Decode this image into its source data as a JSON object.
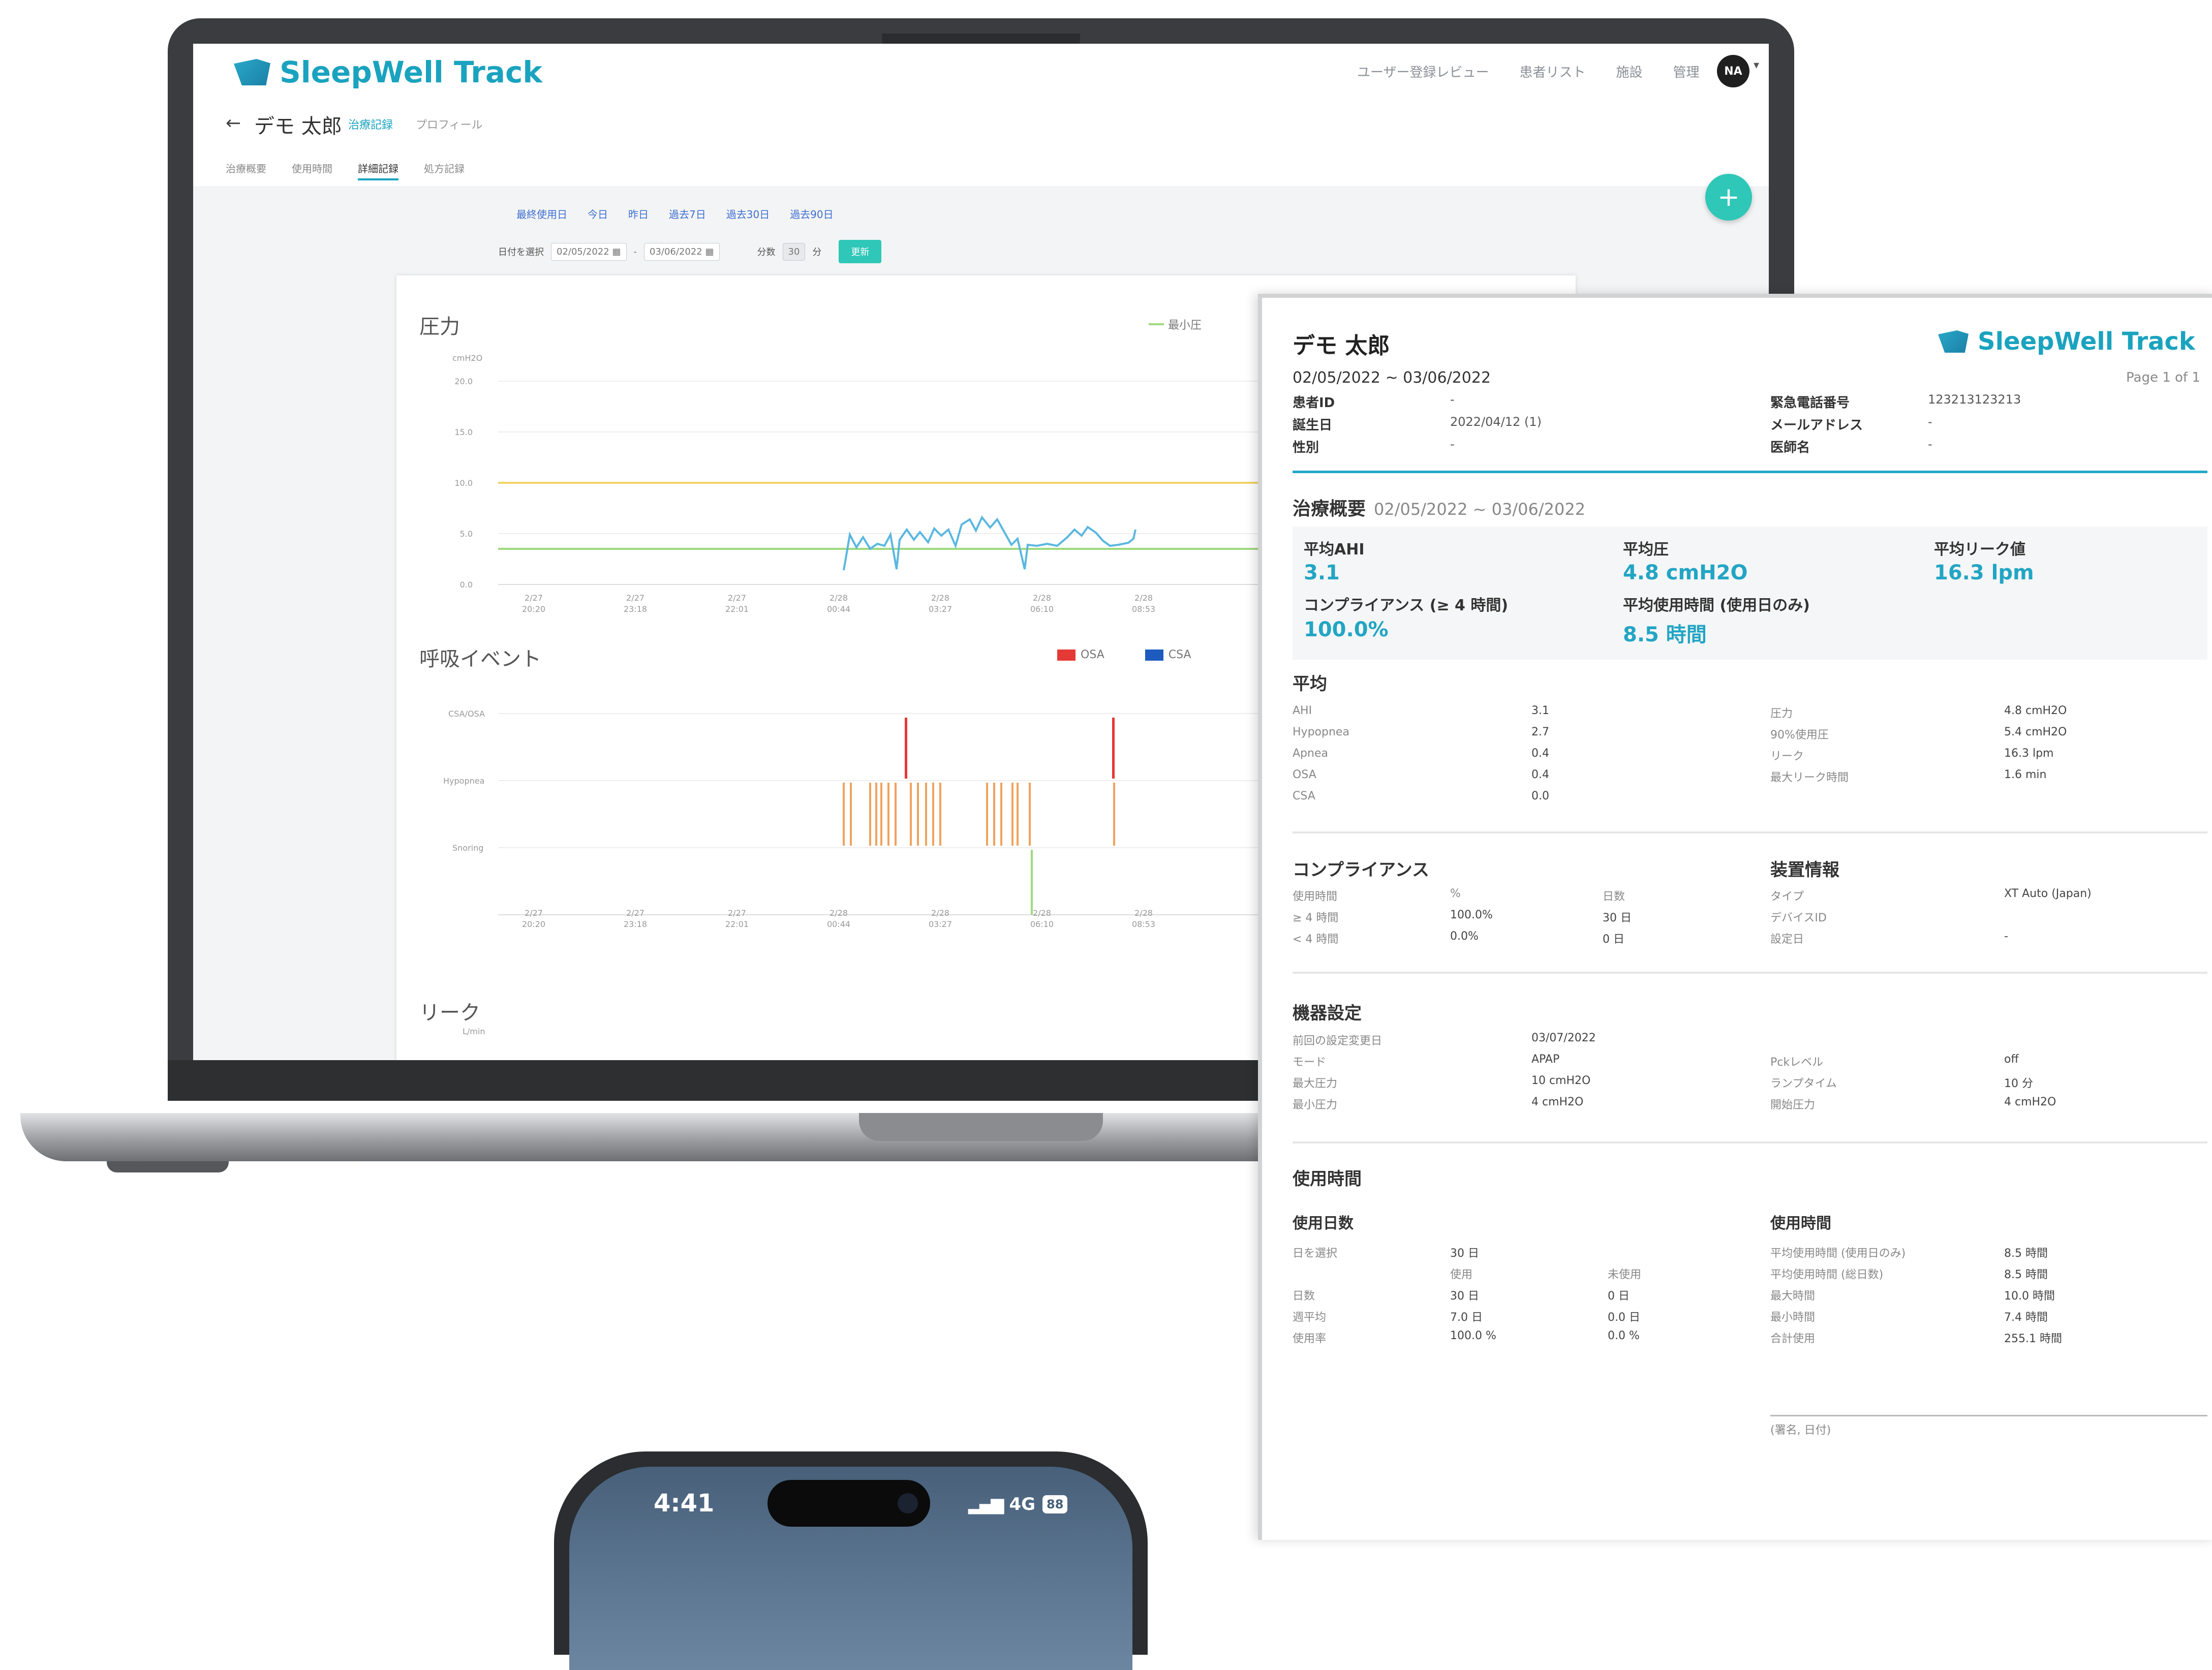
{
  "app": {
    "name": "SleepWell Track",
    "nav": [
      "ユーザー登録レビュー",
      "患者リスト",
      "施設",
      "管理"
    ],
    "avatar_initials": "NA",
    "add_button": "+",
    "patient_name": "デモ 太郎",
    "patient_tabs": [
      "治療記録",
      "プロフィール"
    ],
    "sub_tabs": [
      "治療概要",
      "使用時間",
      "詳細記録",
      "処方記録"
    ],
    "presets": [
      "最終使用日",
      "今日",
      "昨日",
      "過去7日",
      "過去30日",
      "過去90日"
    ],
    "date_label": "日付を選択",
    "date_from": "02/05/2022",
    "date_to": "03/06/2022",
    "interval_label": "分数",
    "interval_value": "30",
    "interval_unit": "分",
    "update_button": "更新",
    "colors": {
      "brand": "#1aa3bf",
      "fab": "#2ec7b8",
      "pressure_line": "#5bb7e0",
      "max_line": "#f3d26a",
      "min_line": "#9fd97f",
      "osa": "#e53935",
      "csa": "#1e5bbf",
      "hypopnea": "#f0a25e",
      "snoring": "#9fd97f"
    }
  },
  "pressure_chart": {
    "title": "圧力",
    "ylabel": "cmH2O",
    "legend": "最小圧",
    "yticks": [
      "20.0",
      "15.0",
      "10.0",
      "5.0",
      "0.0"
    ],
    "xticks": [
      [
        "2/27",
        "20:20"
      ],
      [
        "2/27",
        "23:18"
      ],
      [
        "2/27",
        "22:01"
      ],
      [
        "2/28",
        "00:44"
      ],
      [
        "2/28",
        "03:27"
      ],
      [
        "2/28",
        "06:10"
      ],
      [
        "2/28",
        "08:53"
      ]
    ]
  },
  "events_chart": {
    "title": "呼吸イベント",
    "legend": [
      "OSA",
      "CSA"
    ],
    "rows": [
      "CSA/OSA",
      "Hypopnea",
      "Snoring"
    ],
    "xticks": [
      [
        "2/27",
        "20:20"
      ],
      [
        "2/27",
        "23:18"
      ],
      [
        "2/27",
        "22:01"
      ],
      [
        "2/28",
        "00:44"
      ],
      [
        "2/28",
        "03:27"
      ],
      [
        "2/28",
        "06:10"
      ],
      [
        "2/28",
        "08:53"
      ]
    ]
  },
  "leak_chart": {
    "title": "リーク",
    "ylabel": "L/min"
  },
  "report": {
    "name": "デモ 太郎",
    "range": "02/05/2022 ~ 03/06/2022",
    "page": "Page 1 of 1",
    "info_left": [
      [
        "患者ID",
        "-"
      ],
      [
        "誕生日",
        "2022/04/12 (1)"
      ],
      [
        "性別",
        "-"
      ]
    ],
    "info_right": [
      [
        "緊急電話番号",
        "123213123213"
      ],
      [
        "メールアドレス",
        "-"
      ],
      [
        "医師名",
        "-"
      ]
    ],
    "summary_title": "治療概要",
    "summary_range": "02/05/2022 ~ 03/06/2022",
    "summary": {
      "avg_ahi_label": "平均AHI",
      "avg_ahi": "3.1",
      "avg_pressure_label": "平均圧",
      "avg_pressure": "4.8 cmH2O",
      "avg_leak_label": "平均リーク値",
      "avg_leak": "16.3 lpm",
      "compliance_label": "コンプライアンス (≥ 4 時間)",
      "compliance": "100.0%",
      "avg_use_label": "平均使用時間 (使用日のみ)",
      "avg_use": "8.5 時間"
    },
    "averages_title": "平均",
    "averages_left": [
      [
        "AHI",
        "3.1"
      ],
      [
        "Hypopnea",
        "2.7"
      ],
      [
        "Apnea",
        "0.4"
      ],
      [
        "OSA",
        "0.4"
      ],
      [
        "CSA",
        "0.0"
      ]
    ],
    "averages_right": [
      [
        "圧力",
        "4.8 cmH2O"
      ],
      [
        "90%使用圧",
        "5.4 cmH2O"
      ],
      [
        "リーク",
        "16.3 lpm"
      ],
      [
        "最大リーク時間",
        "1.6 min"
      ]
    ],
    "compliance_title": "コンプライアンス",
    "compliance_header": [
      "使用時間",
      "%",
      "日数"
    ],
    "compliance_rows": [
      [
        "≥ 4 時間",
        "100.0%",
        "30 日"
      ],
      [
        "< 4 時間",
        "0.0%",
        "0 日"
      ]
    ],
    "device_title": "装置情報",
    "device_rows": [
      [
        "タイプ",
        "XT Auto (Japan)"
      ],
      [
        "デバイスID",
        ""
      ],
      [
        "設定日",
        "-"
      ]
    ],
    "settings_title": "機器設定",
    "settings_left": [
      [
        "前回の設定変更日",
        "03/07/2022"
      ],
      [
        "モード",
        "APAP"
      ],
      [
        "最大圧力",
        "10 cmH2O"
      ],
      [
        "最小圧力",
        "4 cmH2O"
      ]
    ],
    "settings_right": [
      [
        "Pckレベル",
        "off"
      ],
      [
        "ランプタイム",
        "10 分"
      ],
      [
        "開始圧力",
        "4 cmH2O"
      ]
    ],
    "usage_title": "使用時間",
    "usage_days_title": "使用日数",
    "usage_days_select": [
      "日を選択",
      "30 日"
    ],
    "usage_days_header": [
      "使用",
      "未使用"
    ],
    "usage_days_rows": [
      [
        "日数",
        "30 日",
        "0 日"
      ],
      [
        "週平均",
        "7.0 日",
        "0.0 日"
      ],
      [
        "使用率",
        "100.0 %",
        "0.0 %"
      ]
    ],
    "usage_hours_title": "使用時間",
    "usage_hours_rows": [
      [
        "平均使用時間 (使用日のみ)",
        "8.5 時間"
      ],
      [
        "平均使用時間 (総日数)",
        "8.5 時間"
      ],
      [
        "最大時間",
        "10.0 時間"
      ],
      [
        "最小時間",
        "7.4 時間"
      ],
      [
        "合計使用",
        "255.1 時間"
      ]
    ],
    "signature": "(署名, 日付)"
  },
  "phone": {
    "time": "4:41",
    "network": "4G",
    "battery": "88"
  }
}
